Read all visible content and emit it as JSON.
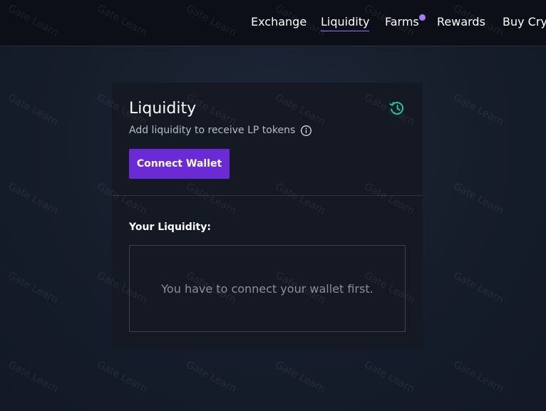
{
  "nav": {
    "items": [
      {
        "label": "Exchange"
      },
      {
        "label": "Liquidity"
      },
      {
        "label": "Farms"
      },
      {
        "label": "Rewards"
      },
      {
        "label": "Buy Cryp"
      }
    ]
  },
  "card": {
    "title": "Liquidity",
    "subtitle": "Add liquidity to receive LP tokens",
    "connect_label": "Connect Wallet",
    "your_liquidity_label": "Your Liquidity:",
    "empty_message": "You have to connect your wallet first."
  },
  "watermark": {
    "text": "Gate Learn"
  },
  "colors": {
    "accent": "#6a2bd6",
    "nav_dot": "#a77dff",
    "history_icon": "#1ec5a0"
  }
}
